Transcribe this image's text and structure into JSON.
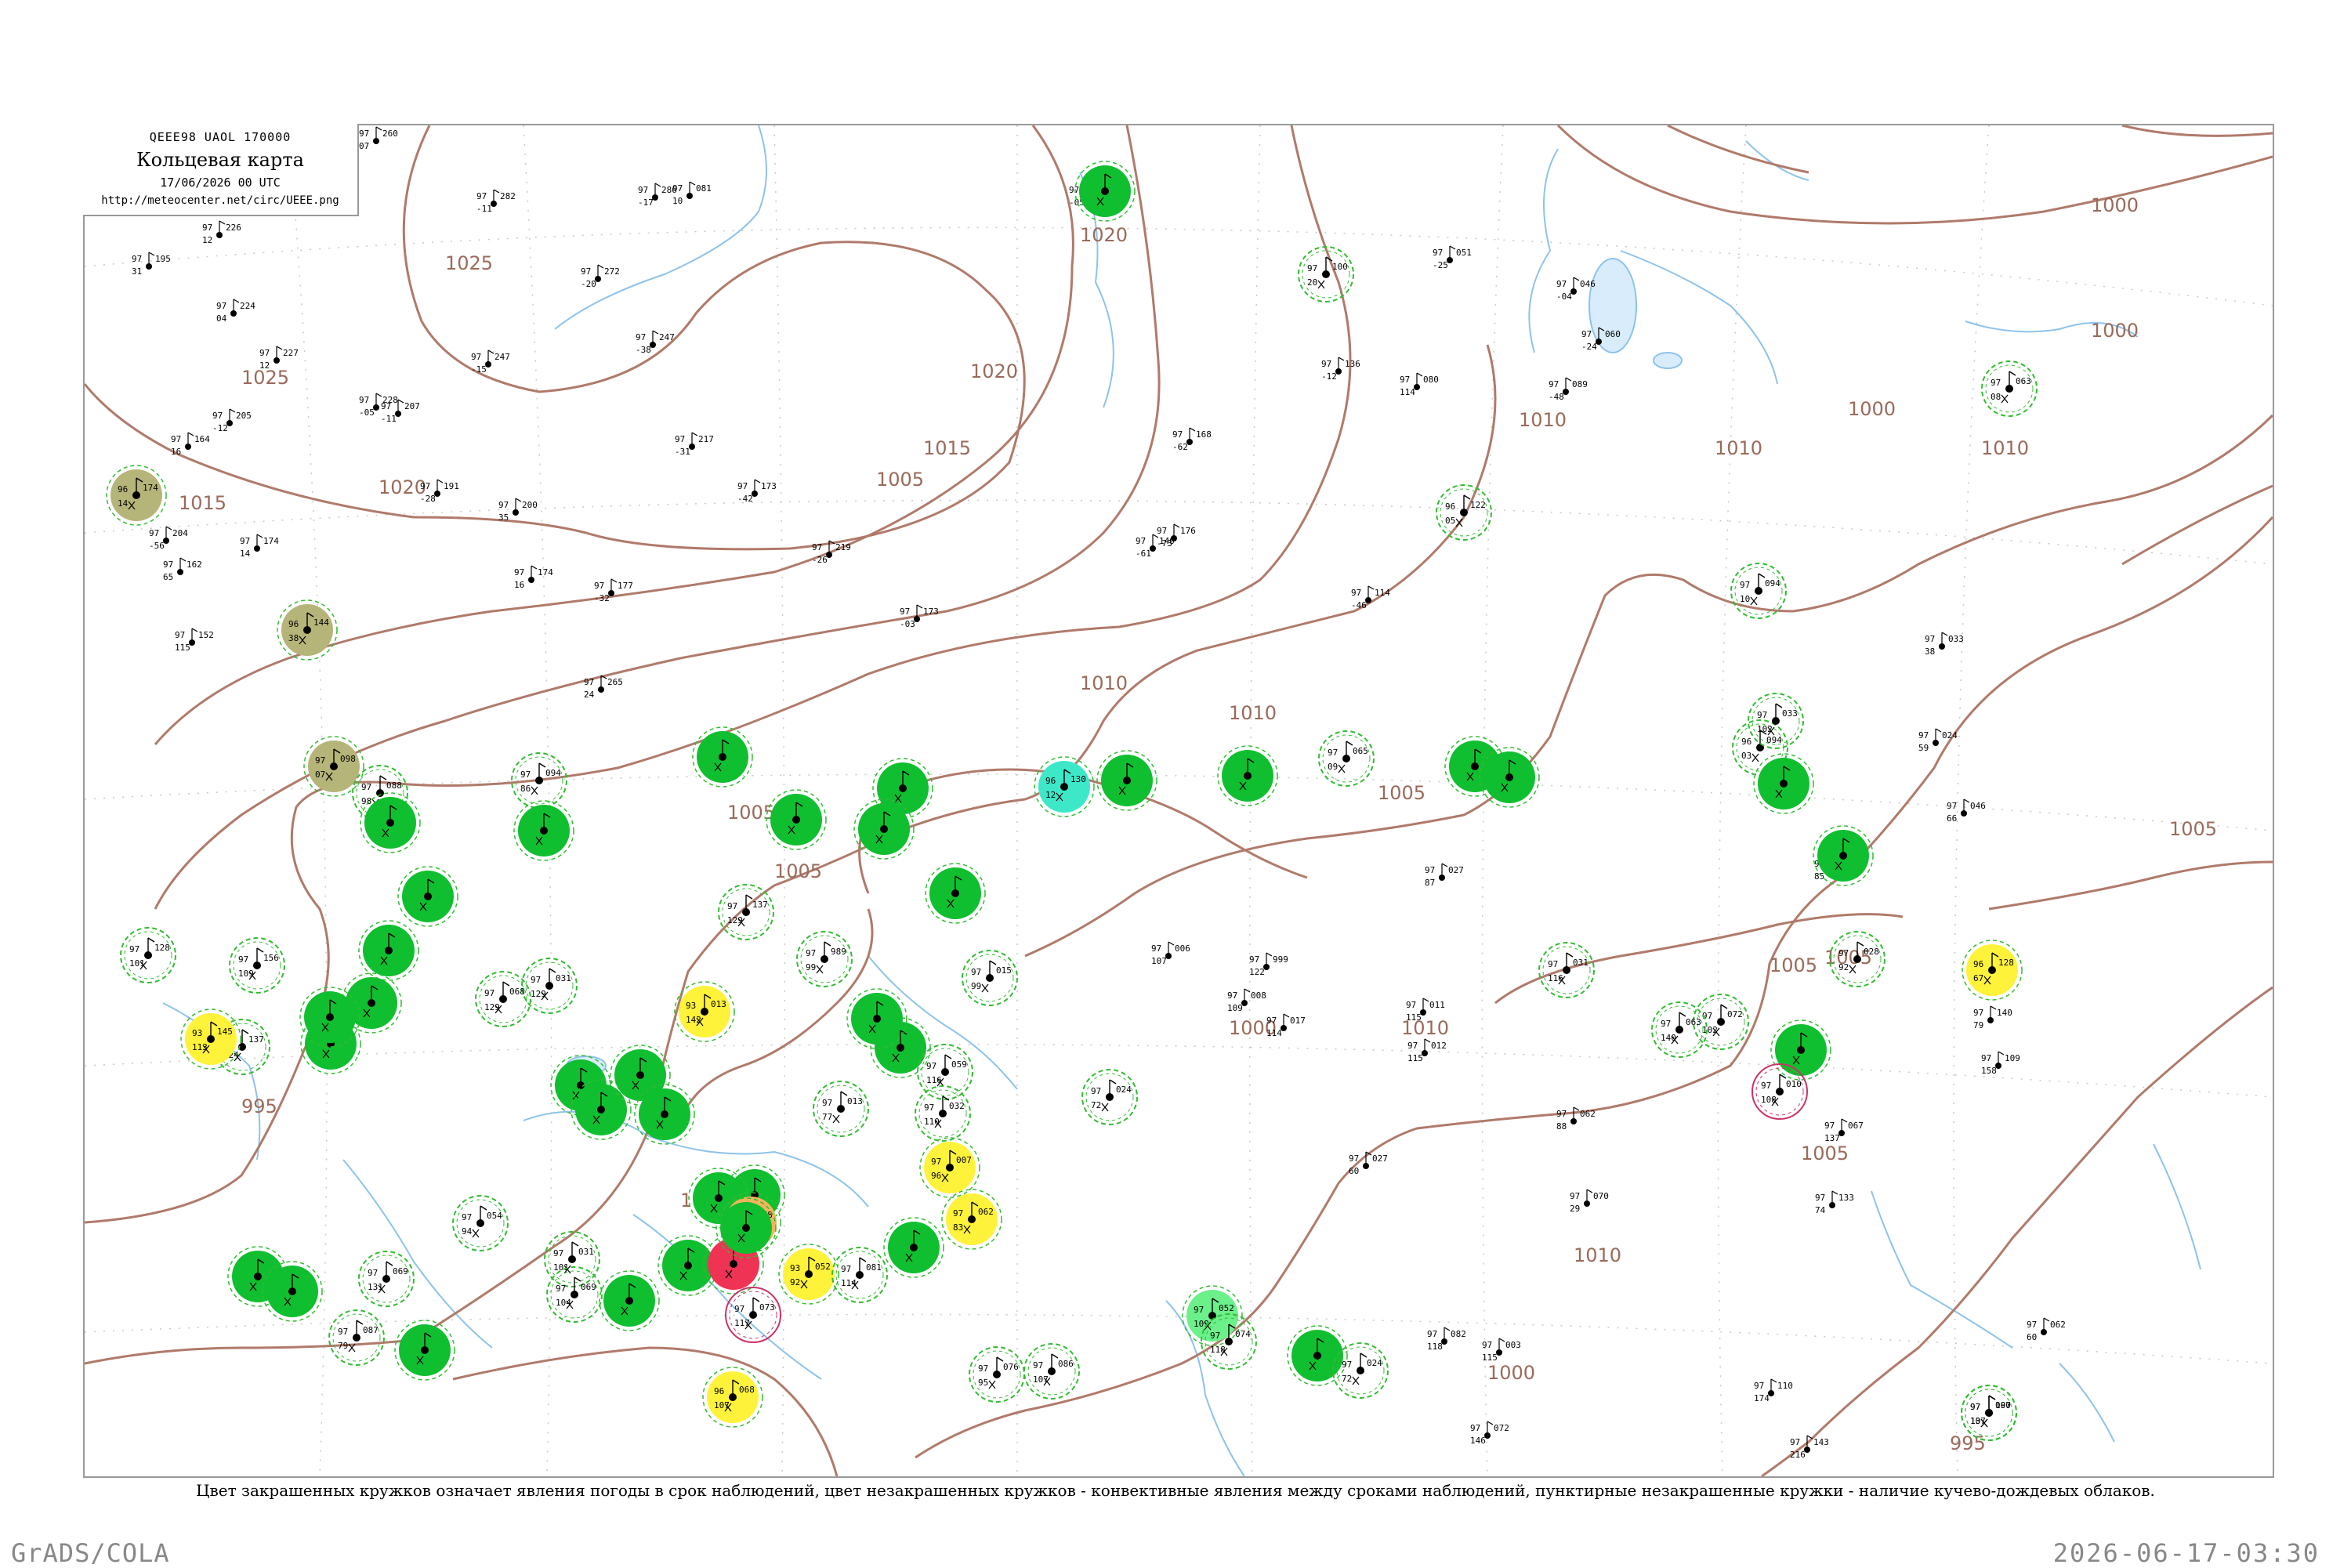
{
  "header": {
    "code": "QEEE98  UAOL  170000",
    "title": "Кольцевая карта",
    "date": "17/06/2026 00 UTC",
    "url": "http://meteocenter.net/circ/UEEE.png"
  },
  "caption": "Цвет закрашенных кружков означает явления погоды в срок наблюдений, цвет незакрашенных кружков - конвективные явления между сроками наблюдений, пунктирные незакрашенные кружки - наличие кучево-дождевых облаков.",
  "footer": {
    "left": "GrADS/COLA",
    "right": "2026-06-17-03:30"
  },
  "colors": {
    "isobar": "#b07a6a",
    "river": "#8ec3ea",
    "green_fill": "#0fbf2f",
    "green_ring": "#33bb33",
    "yellow_fill": "#fff23a",
    "orange_fill": "#f2b55a",
    "red_fill": "#ee3355",
    "olive_fill": "#b5b57a",
    "teal_fill": "#3de8c8",
    "light_green_fill": "#6cf08a",
    "pink_ring": "#cc3366"
  },
  "isobar_labels": [
    "1025",
    "1025",
    "1020",
    "1020",
    "1020",
    "1015",
    "1015",
    "1010",
    "1010",
    "1010",
    "1010",
    "1005",
    "1005",
    "1005",
    "1005",
    "1005",
    "1005",
    "1000",
    "1000",
    "1000",
    "1000",
    "1000",
    "995",
    "995",
    "1010",
    "1005",
    "1005",
    "1010",
    "1010",
    "1005"
  ],
  "stations": [
    {
      "id": "st1",
      "kind": "fill",
      "color": "green",
      "p": "",
      "t": "",
      "d": ""
    },
    {
      "id": "st2",
      "kind": "ring",
      "color": "green",
      "p": "100",
      "t": "97",
      "d": "20"
    },
    {
      "id": "st3",
      "kind": "fill",
      "color": "olive",
      "p": "174",
      "t": "96",
      "d": "14"
    },
    {
      "id": "st4",
      "kind": "fill",
      "color": "olive",
      "p": "144",
      "t": "96",
      "d": "38"
    },
    {
      "id": "st5",
      "kind": "fill",
      "color": "olive",
      "p": "098",
      "t": "97",
      "d": "07"
    },
    {
      "id": "st6",
      "kind": "ring",
      "color": "green",
      "p": "122",
      "t": "96",
      "d": "05"
    },
    {
      "id": "st7",
      "kind": "ring",
      "color": "green",
      "p": "094",
      "t": "97",
      "d": "10"
    },
    {
      "id": "st8",
      "kind": "ring",
      "color": "green",
      "p": "063",
      "t": "97",
      "d": "08"
    },
    {
      "id": "st9",
      "kind": "ring",
      "color": "green",
      "p": "094",
      "t": "96",
      "d": "03"
    },
    {
      "id": "st10",
      "kind": "fill",
      "color": "green",
      "p": "",
      "t": "",
      "d": ""
    },
    {
      "id": "st11",
      "kind": "ring",
      "color": "green",
      "p": "065",
      "t": "97",
      "d": "09"
    },
    {
      "id": "st12",
      "kind": "fill",
      "color": "green",
      "p": "",
      "t": "",
      "d": ""
    },
    {
      "id": "st13",
      "kind": "fill",
      "color": "green",
      "p": "",
      "t": "",
      "d": ""
    },
    {
      "id": "st14",
      "kind": "fill",
      "color": "green",
      "p": "",
      "t": "",
      "d": ""
    },
    {
      "id": "st15",
      "kind": "fill",
      "color": "teal",
      "p": "130",
      "t": "96",
      "d": "12"
    },
    {
      "id": "st16",
      "kind": "fill",
      "color": "green",
      "p": "",
      "t": "",
      "d": ""
    },
    {
      "id": "st17",
      "kind": "fill",
      "color": "green",
      "p": "",
      "t": "",
      "d": ""
    },
    {
      "id": "st18",
      "kind": "fill",
      "color": "green",
      "p": "",
      "t": "",
      "d": ""
    },
    {
      "id": "st19",
      "kind": "fill",
      "color": "green",
      "p": "",
      "t": "",
      "d": ""
    },
    {
      "id": "st20",
      "kind": "ring",
      "color": "green",
      "p": "033",
      "t": "97",
      "d": "102"
    },
    {
      "id": "st21",
      "kind": "fill",
      "color": "green",
      "p": "",
      "t": "",
      "d": ""
    },
    {
      "id": "st22",
      "kind": "ring",
      "color": "green",
      "p": "094",
      "t": "97",
      "d": "86"
    },
    {
      "id": "st23",
      "kind": "fill",
      "color": "green",
      "p": "",
      "t": "",
      "d": ""
    },
    {
      "id": "st24",
      "kind": "ring",
      "color": "green",
      "p": "088",
      "t": "97",
      "d": "98"
    },
    {
      "id": "st25",
      "kind": "fill",
      "color": "green",
      "p": "",
      "t": "",
      "d": ""
    },
    {
      "id": "st26",
      "kind": "fill",
      "color": "green",
      "p": "",
      "t": "",
      "d": ""
    },
    {
      "id": "st27",
      "kind": "fill",
      "color": "green",
      "p": "",
      "t": "",
      "d": ""
    },
    {
      "id": "st28",
      "kind": "ring",
      "color": "green",
      "p": "989",
      "t": "97",
      "d": "99"
    },
    {
      "id": "st29",
      "kind": "ring",
      "color": "green",
      "p": "015",
      "t": "97",
      "d": "99"
    },
    {
      "id": "st30",
      "kind": "fill",
      "color": "green",
      "p": "",
      "t": "",
      "d": ""
    },
    {
      "id": "st31",
      "kind": "ring",
      "color": "green",
      "p": "137",
      "t": "97",
      "d": "129"
    },
    {
      "id": "st32",
      "kind": "ring",
      "color": "green",
      "p": "156",
      "t": "97",
      "d": "109"
    },
    {
      "id": "st33",
      "kind": "ring",
      "color": "green",
      "p": "128",
      "t": "97",
      "d": "101"
    },
    {
      "id": "st34",
      "kind": "ring",
      "color": "green",
      "p": "137",
      "t": "97",
      "d": "124"
    },
    {
      "id": "st35",
      "kind": "fill",
      "color": "yellow",
      "p": "145",
      "t": "93",
      "d": "113"
    },
    {
      "id": "st36",
      "kind": "fill",
      "color": "green",
      "p": "",
      "t": "",
      "d": ""
    },
    {
      "id": "st37",
      "kind": "fill",
      "color": "green",
      "p": "",
      "t": "",
      "d": ""
    },
    {
      "id": "st38",
      "kind": "fill",
      "color": "green",
      "p": "",
      "t": "",
      "d": ""
    },
    {
      "id": "st39",
      "kind": "fill",
      "color": "green",
      "p": "",
      "t": "",
      "d": ""
    },
    {
      "id": "st40",
      "kind": "ring",
      "color": "green",
      "p": "031",
      "t": "97",
      "d": "129"
    },
    {
      "id": "st41",
      "kind": "ring",
      "color": "green",
      "p": "068",
      "t": "97",
      "d": "129"
    },
    {
      "id": "st42",
      "kind": "fill",
      "color": "yellow",
      "p": "013",
      "t": "93",
      "d": "142"
    },
    {
      "id": "st43",
      "kind": "fill",
      "color": "green",
      "p": "",
      "t": "",
      "d": ""
    },
    {
      "id": "st44",
      "kind": "fill",
      "color": "green",
      "p": "",
      "t": "",
      "d": ""
    },
    {
      "id": "st45",
      "kind": "ring",
      "color": "green",
      "p": "059",
      "t": "97",
      "d": "116"
    },
    {
      "id": "st46",
      "kind": "fill",
      "color": "green",
      "p": "",
      "t": "",
      "d": ""
    },
    {
      "id": "st47",
      "kind": "fill",
      "color": "green",
      "p": "",
      "t": "",
      "d": ""
    },
    {
      "id": "st48",
      "kind": "fill",
      "color": "green",
      "p": "",
      "t": "",
      "d": ""
    },
    {
      "id": "st49",
      "kind": "fill",
      "color": "green",
      "p": "",
      "t": "",
      "d": ""
    },
    {
      "id": "st50",
      "kind": "ring",
      "color": "green",
      "p": "032",
      "t": "97",
      "d": "110"
    },
    {
      "id": "st51",
      "kind": "ring",
      "color": "green",
      "p": "013",
      "t": "97",
      "d": "77"
    },
    {
      "id": "st52",
      "kind": "ring",
      "color": "green",
      "p": "024",
      "t": "97",
      "d": "72"
    },
    {
      "id": "st53",
      "kind": "fill",
      "color": "yellow",
      "p": "007",
      "t": "97",
      "d": "96"
    },
    {
      "id": "st54",
      "kind": "fill",
      "color": "yellow",
      "p": "062",
      "t": "97",
      "d": "83"
    },
    {
      "id": "st55",
      "kind": "fill",
      "color": "green",
      "p": "",
      "t": "",
      "d": ""
    },
    {
      "id": "st56",
      "kind": "fill",
      "color": "green",
      "p": "",
      "t": "",
      "d": ""
    },
    {
      "id": "st57",
      "kind": "fill",
      "color": "green",
      "p": "",
      "t": "",
      "d": ""
    },
    {
      "id": "st58",
      "kind": "fill",
      "color": "green",
      "p": "",
      "t": "",
      "d": ""
    },
    {
      "id": "st59",
      "kind": "fill",
      "color": "red",
      "p": "",
      "t": "",
      "d": ""
    },
    {
      "id": "st60",
      "kind": "fill",
      "color": "orange",
      "p": "078",
      "t": "96",
      "d": "103"
    },
    {
      "id": "st61",
      "kind": "ring",
      "color": "green",
      "p": "054",
      "t": "97",
      "d": "94"
    },
    {
      "id": "st62",
      "kind": "ring",
      "color": "green",
      "p": "031",
      "t": "97",
      "d": "101"
    },
    {
      "id": "st63",
      "kind": "ring",
      "color": "green",
      "p": "069",
      "t": "97",
      "d": "104"
    },
    {
      "id": "st64",
      "kind": "fill",
      "color": "green",
      "p": "",
      "t": "",
      "d": ""
    },
    {
      "id": "st65",
      "kind": "fill",
      "color": "green",
      "p": "",
      "t": "",
      "d": ""
    },
    {
      "id": "st66",
      "kind": "fill",
      "color": "yellow",
      "p": "052",
      "t": "93",
      "d": "92"
    },
    {
      "id": "st67",
      "kind": "ring",
      "color": "green",
      "p": "081",
      "t": "97",
      "d": "114"
    },
    {
      "id": "st68",
      "kind": "ring",
      "color": "pink",
      "p": "073",
      "t": "97",
      "d": "117"
    },
    {
      "id": "st69",
      "kind": "fill",
      "color": "green",
      "p": "",
      "t": "",
      "d": ""
    },
    {
      "id": "st70",
      "kind": "fill",
      "color": "green",
      "p": "",
      "t": "",
      "d": ""
    },
    {
      "id": "st71",
      "kind": "ring",
      "color": "green",
      "p": "069",
      "t": "97",
      "d": "131"
    },
    {
      "id": "st72",
      "kind": "ring",
      "color": "green",
      "p": "087",
      "t": "97",
      "d": "79"
    },
    {
      "id": "st73",
      "kind": "fill",
      "color": "green",
      "p": "",
      "t": "",
      "d": ""
    },
    {
      "id": "st74",
      "kind": "ring",
      "color": "green",
      "p": "076",
      "t": "97",
      "d": "95"
    },
    {
      "id": "st75",
      "kind": "ring",
      "color": "green",
      "p": "086",
      "t": "97",
      "d": "107"
    },
    {
      "id": "st76",
      "kind": "fill",
      "color": "yellow",
      "p": "068",
      "t": "96",
      "d": "107"
    },
    {
      "id": "st77",
      "kind": "fill",
      "color": "light_green",
      "p": "052",
      "t": "97",
      "d": "109"
    },
    {
      "id": "st78",
      "kind": "ring",
      "color": "green",
      "p": "074",
      "t": "97",
      "d": "118"
    },
    {
      "id": "st79",
      "kind": "fill",
      "color": "green",
      "p": "",
      "t": "",
      "d": ""
    },
    {
      "id": "st80",
      "kind": "ring",
      "color": "green",
      "p": "024",
      "t": "97",
      "d": "72"
    },
    {
      "id": "st81",
      "kind": "ring",
      "color": "green",
      "p": "072",
      "t": "97",
      "d": "102"
    },
    {
      "id": "st82",
      "kind": "fill",
      "color": "green",
      "p": "",
      "t": "",
      "d": ""
    },
    {
      "id": "st83",
      "kind": "ring",
      "color": "pink",
      "p": "010",
      "t": "97",
      "d": "108"
    },
    {
      "id": "st84",
      "kind": "ring",
      "color": "green",
      "p": "031",
      "t": "97",
      "d": "116"
    },
    {
      "id": "st85",
      "kind": "ring",
      "color": "green",
      "p": "028",
      "t": "97",
      "d": "92"
    },
    {
      "id": "st86",
      "kind": "ring",
      "color": "green",
      "p": "063",
      "t": "97",
      "d": "140"
    },
    {
      "id": "st87",
      "kind": "fill",
      "color": "yellow",
      "p": "128",
      "t": "96",
      "d": "67"
    },
    {
      "id": "st88",
      "kind": "ring",
      "color": "green",
      "p": "100",
      "t": "97",
      "d": "107"
    },
    {
      "id": "st89",
      "kind": "ring",
      "color": "green",
      "p": "097",
      "t": "97",
      "d": "13"
    }
  ],
  "plain_stations": [
    {
      "p": "260",
      "t": "97",
      "d": "07"
    },
    {
      "p": "282",
      "t": "97",
      "d": "-11"
    },
    {
      "p": "226",
      "t": "97",
      "d": "12"
    },
    {
      "p": "195",
      "t": "97",
      "d": "31"
    },
    {
      "p": "224",
      "t": "97",
      "d": "04"
    },
    {
      "p": "227",
      "t": "97",
      "d": "12"
    },
    {
      "p": "205",
      "t": "97",
      "d": "-12"
    },
    {
      "p": "164",
      "t": "97",
      "d": "16"
    },
    {
      "p": "204",
      "t": "97",
      "d": "-56"
    },
    {
      "p": "162",
      "t": "97",
      "d": "65"
    },
    {
      "p": "174",
      "t": "97",
      "d": "14"
    },
    {
      "p": "152",
      "t": "97",
      "d": "115"
    },
    {
      "p": "286",
      "t": "97",
      "d": "-17"
    },
    {
      "p": "081",
      "t": "97",
      "d": "10"
    },
    {
      "p": "272",
      "t": "97",
      "d": "-20"
    },
    {
      "p": "247",
      "t": "97",
      "d": "-15"
    },
    {
      "p": "247",
      "t": "97",
      "d": "-38"
    },
    {
      "p": "217",
      "t": "97",
      "d": "-31"
    },
    {
      "p": "173",
      "t": "97",
      "d": "-42"
    },
    {
      "p": "219",
      "t": "97",
      "d": "-26"
    },
    {
      "p": "173",
      "t": "97",
      "d": "-03"
    },
    {
      "p": "215",
      "t": "97",
      "d": "-05"
    },
    {
      "p": "228",
      "t": "97",
      "d": "-05"
    },
    {
      "p": "207",
      "t": "97",
      "d": "-11"
    },
    {
      "p": "191",
      "t": "97",
      "d": "-28"
    },
    {
      "p": "200",
      "t": "97",
      "d": "35"
    },
    {
      "p": "174",
      "t": "97",
      "d": "16"
    },
    {
      "p": "177",
      "t": "97",
      "d": "-32"
    },
    {
      "p": "265",
      "t": "97",
      "d": "24"
    },
    {
      "p": "136",
      "t": "97",
      "d": "-12"
    },
    {
      "p": "168",
      "t": "97",
      "d": "-62"
    },
    {
      "p": "176",
      "t": "97",
      "d": "-73"
    },
    {
      "p": "140",
      "t": "97",
      "d": "-61"
    },
    {
      "p": "114",
      "t": "97",
      "d": "-46"
    },
    {
      "p": "080",
      "t": "97",
      "d": "114"
    },
    {
      "p": "051",
      "t": "97",
      "d": "-25"
    },
    {
      "p": "046",
      "t": "97",
      "d": "-04"
    },
    {
      "p": "060",
      "t": "97",
      "d": "-24"
    },
    {
      "p": "089",
      "t": "97",
      "d": "-48"
    },
    {
      "p": "033",
      "t": "97",
      "d": "38"
    },
    {
      "p": "024",
      "t": "97",
      "d": "59"
    },
    {
      "p": "046",
      "t": "97",
      "d": "66"
    },
    {
      "p": "045",
      "t": "97",
      "d": "85"
    },
    {
      "p": "027",
      "t": "97",
      "d": "87"
    },
    {
      "p": "006",
      "t": "97",
      "d": "107"
    },
    {
      "p": "999",
      "t": "97",
      "d": "122"
    },
    {
      "p": "008",
      "t": "97",
      "d": "109"
    },
    {
      "p": "017",
      "t": "97",
      "d": "114"
    },
    {
      "p": "011",
      "t": "97",
      "d": "115"
    },
    {
      "p": "012",
      "t": "97",
      "d": "115"
    },
    {
      "p": "027",
      "t": "97",
      "d": "60"
    },
    {
      "p": "062",
      "t": "97",
      "d": "88"
    },
    {
      "p": "070",
      "t": "97",
      "d": "29"
    },
    {
      "p": "067",
      "t": "97",
      "d": "137"
    },
    {
      "p": "133",
      "t": "97",
      "d": "74"
    },
    {
      "p": "140",
      "t": "97",
      "d": "79"
    },
    {
      "p": "109",
      "t": "97",
      "d": "158"
    },
    {
      "p": "062",
      "t": "97",
      "d": "60"
    },
    {
      "p": "082",
      "t": "97",
      "d": "118"
    },
    {
      "p": "072",
      "t": "97",
      "d": "146"
    },
    {
      "p": "003",
      "t": "97",
      "d": "115"
    },
    {
      "p": "110",
      "t": "97",
      "d": "174"
    },
    {
      "p": "143",
      "t": "97",
      "d": "216"
    }
  ]
}
